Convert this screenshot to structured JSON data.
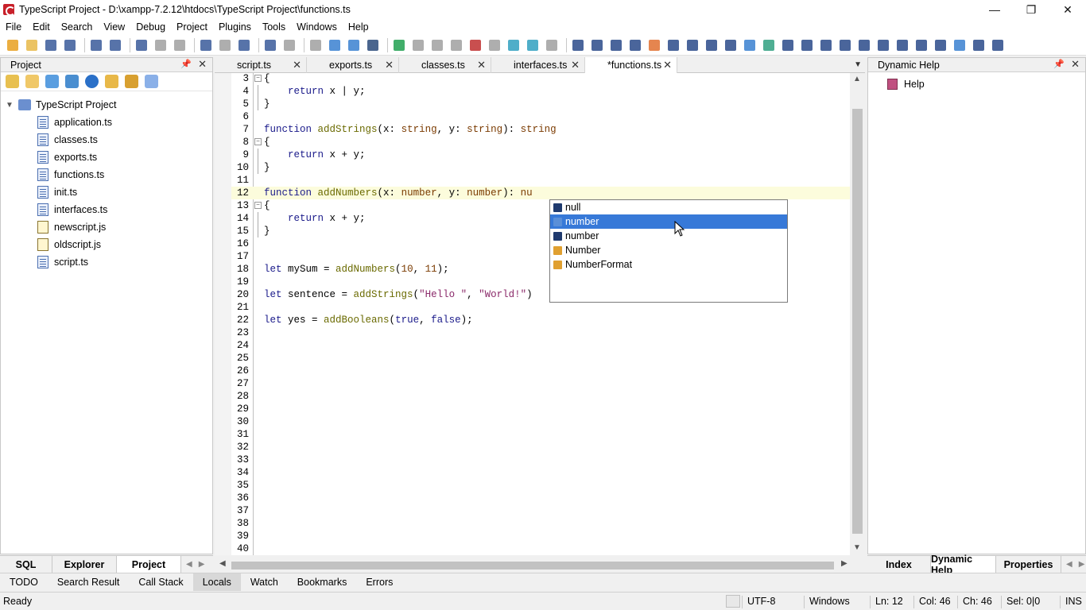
{
  "window": {
    "title": "TypeScript Project - D:\\xampp-7.2.12\\htdocs\\TypeScript Project\\functions.ts",
    "minimize": "—",
    "restore": "❐",
    "close": "✕"
  },
  "menu": [
    "File",
    "Edit",
    "Search",
    "View",
    "Debug",
    "Project",
    "Plugins",
    "Tools",
    "Windows",
    "Help"
  ],
  "left_panel": {
    "title": "Project",
    "pin": "📌",
    "close": "✕",
    "root": "TypeScript Project",
    "files": [
      {
        "name": "application.ts",
        "type": "ts"
      },
      {
        "name": "classes.ts",
        "type": "ts"
      },
      {
        "name": "exports.ts",
        "type": "ts"
      },
      {
        "name": "functions.ts",
        "type": "ts"
      },
      {
        "name": "init.ts",
        "type": "ts"
      },
      {
        "name": "interfaces.ts",
        "type": "ts"
      },
      {
        "name": "newscript.js",
        "type": "js"
      },
      {
        "name": "oldscript.js",
        "type": "js"
      },
      {
        "name": "script.ts",
        "type": "ts"
      }
    ],
    "tabs": [
      "SQL",
      "Explorer",
      "Project"
    ],
    "active_tab": "Project"
  },
  "editor": {
    "tabs": [
      "script.ts",
      "exports.ts",
      "classes.ts",
      "interfaces.ts",
      "*functions.ts"
    ],
    "active_tab": "*functions.ts",
    "current_line": 12,
    "lines": [
      {
        "n": "3",
        "fold": "open",
        "code": [
          [
            "",
            "{"
          ]
        ]
      },
      {
        "n": "4",
        "fold": "bar",
        "code": [
          [
            "",
            "    "
          ],
          [
            "kw",
            "return"
          ],
          [
            "",
            " x | y;"
          ]
        ]
      },
      {
        "n": "5",
        "fold": "end",
        "code": [
          [
            "",
            "}"
          ]
        ]
      },
      {
        "n": "6",
        "fold": "",
        "code": []
      },
      {
        "n": "7",
        "fold": "",
        "code": [
          [
            "kw",
            "function"
          ],
          [
            "",
            " "
          ],
          [
            "fn",
            "addStrings"
          ],
          [
            "",
            "(x: "
          ],
          [
            "ty",
            "string"
          ],
          [
            "",
            ", y: "
          ],
          [
            "ty",
            "string"
          ],
          [
            "",
            "): "
          ],
          [
            "ty",
            "string"
          ]
        ]
      },
      {
        "n": "8",
        "fold": "open",
        "code": [
          [
            "",
            "{"
          ]
        ]
      },
      {
        "n": "9",
        "fold": "bar",
        "code": [
          [
            "",
            "    "
          ],
          [
            "kw",
            "return"
          ],
          [
            "",
            " x + y;"
          ]
        ]
      },
      {
        "n": "10",
        "fold": "end",
        "code": [
          [
            "",
            "}"
          ]
        ]
      },
      {
        "n": "11",
        "fold": "",
        "code": []
      },
      {
        "n": "12",
        "fold": "",
        "code": [
          [
            "kw",
            "function"
          ],
          [
            "",
            " "
          ],
          [
            "fn",
            "addNumbers"
          ],
          [
            "",
            "(x: "
          ],
          [
            "ty",
            "number"
          ],
          [
            "",
            ", y: "
          ],
          [
            "ty",
            "number"
          ],
          [
            "",
            "): "
          ],
          [
            "ty",
            "nu"
          ]
        ]
      },
      {
        "n": "13",
        "fold": "open",
        "code": [
          [
            "",
            "{"
          ]
        ]
      },
      {
        "n": "14",
        "fold": "bar",
        "code": [
          [
            "",
            "    "
          ],
          [
            "kw",
            "return"
          ],
          [
            "",
            " x + y;"
          ]
        ]
      },
      {
        "n": "15",
        "fold": "end",
        "code": [
          [
            "",
            "}"
          ]
        ]
      },
      {
        "n": "16",
        "fold": "",
        "code": []
      },
      {
        "n": "17",
        "fold": "",
        "code": []
      },
      {
        "n": "18",
        "fold": "",
        "code": [
          [
            "kw",
            "let"
          ],
          [
            "",
            " mySum = "
          ],
          [
            "fn",
            "addNumbers"
          ],
          [
            "",
            "("
          ],
          [
            "numl",
            "10"
          ],
          [
            "",
            ", "
          ],
          [
            "numl",
            "11"
          ],
          [
            "",
            ");"
          ]
        ]
      },
      {
        "n": "19",
        "fold": "",
        "code": []
      },
      {
        "n": "20",
        "fold": "",
        "code": [
          [
            "kw",
            "let"
          ],
          [
            "",
            " sentence = "
          ],
          [
            "fn",
            "addStrings"
          ],
          [
            "",
            "("
          ],
          [
            "str",
            "\"Hello \""
          ],
          [
            "",
            ", "
          ],
          [
            "str",
            "\"World!\""
          ],
          [
            "",
            ")"
          ]
        ]
      },
      {
        "n": "21",
        "fold": "",
        "code": []
      },
      {
        "n": "22",
        "fold": "",
        "code": [
          [
            "kw",
            "let"
          ],
          [
            "",
            " yes = "
          ],
          [
            "fn",
            "addBooleans"
          ],
          [
            "",
            "("
          ],
          [
            "kw",
            "true"
          ],
          [
            "",
            ", "
          ],
          [
            "kw",
            "false"
          ],
          [
            "",
            ");"
          ]
        ]
      },
      {
        "n": "23",
        "fold": "",
        "code": []
      },
      {
        "n": "24",
        "fold": "",
        "code": []
      },
      {
        "n": "25",
        "fold": "",
        "code": []
      },
      {
        "n": "26",
        "fold": "",
        "code": []
      },
      {
        "n": "27",
        "fold": "",
        "code": []
      },
      {
        "n": "28",
        "fold": "",
        "code": []
      },
      {
        "n": "29",
        "fold": "",
        "code": []
      },
      {
        "n": "30",
        "fold": "",
        "code": []
      },
      {
        "n": "31",
        "fold": "",
        "code": []
      },
      {
        "n": "32",
        "fold": "",
        "code": []
      },
      {
        "n": "33",
        "fold": "",
        "code": []
      },
      {
        "n": "34",
        "fold": "",
        "code": []
      },
      {
        "n": "35",
        "fold": "",
        "code": []
      },
      {
        "n": "36",
        "fold": "",
        "code": []
      },
      {
        "n": "37",
        "fold": "",
        "code": []
      },
      {
        "n": "38",
        "fold": "",
        "code": []
      },
      {
        "n": "39",
        "fold": "",
        "code": []
      },
      {
        "n": "40",
        "fold": "",
        "code": []
      }
    ]
  },
  "autocomplete": {
    "items": [
      {
        "label": "null",
        "icon": "keyword-icon",
        "color": "#1f3a6e"
      },
      {
        "label": "number",
        "icon": "interface-icon",
        "color": "#5a8fd8",
        "selected": true
      },
      {
        "label": "number",
        "icon": "keyword-icon",
        "color": "#1f3a6e"
      },
      {
        "label": "Number",
        "icon": "class-icon",
        "color": "#e0a030"
      },
      {
        "label": "NumberFormat",
        "icon": "class-icon",
        "color": "#e0a030"
      }
    ]
  },
  "right_panel": {
    "title": "Dynamic Help",
    "pin": "📌",
    "close": "✕",
    "item": "Help",
    "tabs": [
      "Index",
      "Dynamic Help",
      "Properties"
    ],
    "active_tab": "Dynamic Help"
  },
  "bottom_tabs": [
    "TODO",
    "Search Result",
    "Call Stack",
    "Locals",
    "Watch",
    "Bookmarks",
    "Errors"
  ],
  "active_bottom_tab": "Locals",
  "status": {
    "ready": "Ready",
    "encoding": "UTF-8",
    "eol": "Windows",
    "line": "Ln: 12",
    "col": "Col: 46",
    "ch": "Ch: 46",
    "sel": "Sel: 0|0",
    "mode": "INS"
  }
}
